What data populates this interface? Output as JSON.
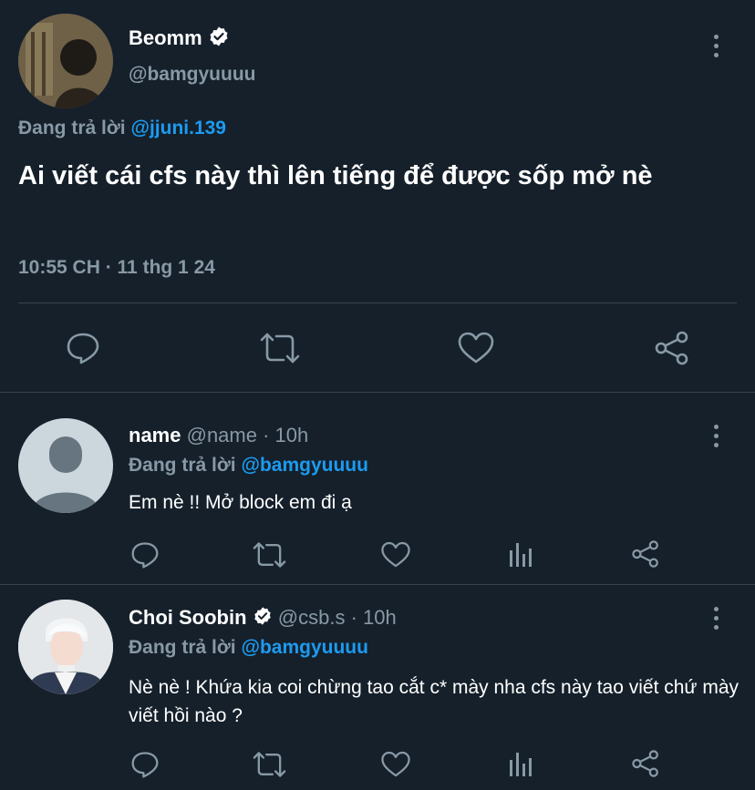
{
  "main_tweet": {
    "display_name": "Beomm",
    "handle": "@bamgyuuuu",
    "reply_prefix": "Đang trả lời",
    "reply_to": "@jjuni.139",
    "text": "Ai viết cái cfs này thì lên tiếng để được sốp mở nè",
    "timestamp": "10:55 CH · 11 thg 1 24"
  },
  "replies": [
    {
      "display_name": "name",
      "handle": "@name",
      "time": "· 10h",
      "reply_prefix": "Đang trả lời",
      "reply_to": "@bamgyuuuu",
      "text": "Em nè !! Mở block em đi ạ"
    },
    {
      "display_name": "Choi Soobin",
      "handle": "@csb.s",
      "time": "· 10h",
      "reply_prefix": "Đang trả lời",
      "reply_to": "@bamgyuuuu",
      "text": "Nè nè ! Khứa kia coi chừng tao cắt c* mày nha cfs này tao viết chứ mày viết hồi nào ?"
    }
  ],
  "colors": {
    "background": "#15202b",
    "text": "#ffffff",
    "muted": "#8899a6",
    "accent": "#1d9bf0",
    "divider": "#38444d"
  },
  "icons": [
    "verified-badge-icon",
    "more-options-icon",
    "reply-icon",
    "retweet-icon",
    "like-icon",
    "analytics-icon",
    "share-icon"
  ]
}
